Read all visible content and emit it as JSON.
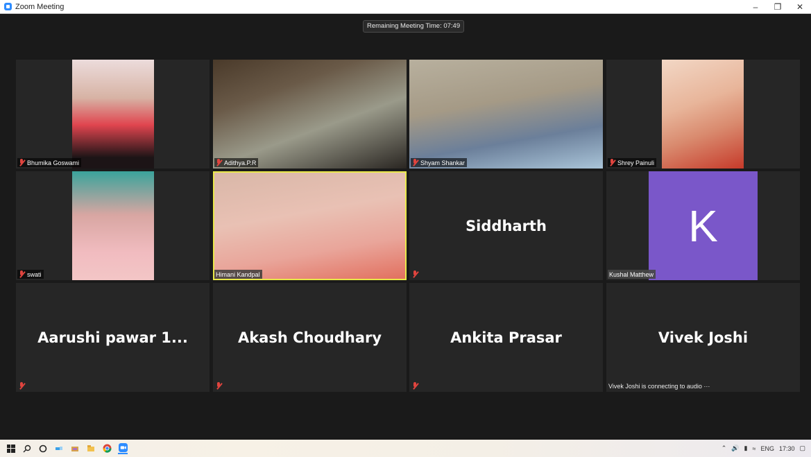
{
  "window": {
    "title": "Zoom Meeting"
  },
  "meeting": {
    "remaining_label": "Remaining Meeting Time: 07:49"
  },
  "participants": [
    {
      "name": "Bhumika Goswami"
    },
    {
      "name": "Adithya.P.R"
    },
    {
      "name": "Shyam Shankar"
    },
    {
      "name": "Shrey Painuli"
    },
    {
      "name": "swati"
    },
    {
      "name": "Himani Kandpal"
    },
    {
      "name": "Siddharth"
    },
    {
      "name": "Kushal Matthew",
      "avatar_letter": "K"
    },
    {
      "name": "Aarushi pawar 1..."
    },
    {
      "name": "Akash Choudhary"
    },
    {
      "name": "Ankita Prasar"
    },
    {
      "name": "Vivek Joshi",
      "status": "Vivek Joshi is connecting to audio ···"
    }
  ],
  "taskbar": {
    "lang": "ENG",
    "time": "17:30"
  },
  "colors": {
    "active_border": "#e9e84a",
    "muted_mic": "#e0443e",
    "avatar_bg": "#7a57c9",
    "zoom_blue": "#2d8cff"
  }
}
